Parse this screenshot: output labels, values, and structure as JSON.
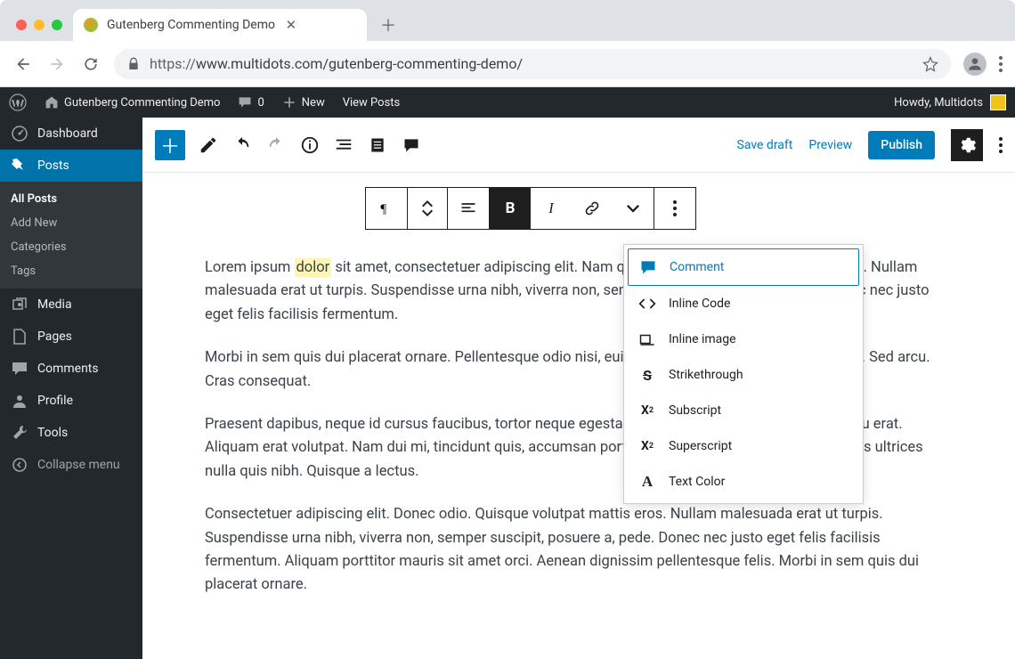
{
  "browser": {
    "tab_title": "Gutenberg Commenting Demo",
    "url_protocol": "https://",
    "url_rest": "www.multidots.com/gutenberg-commenting-demo/"
  },
  "adminbar": {
    "site_name": "Gutenberg Commenting Demo",
    "comment_count": "0",
    "new_label": "New",
    "view_posts": "View Posts",
    "howdy": "Howdy, Multidots"
  },
  "sidebar": {
    "dashboard": "Dashboard",
    "posts": "Posts",
    "posts_sub": {
      "all": "All Posts",
      "add": "Add New",
      "cats": "Categories",
      "tags": "Tags"
    },
    "media": "Media",
    "pages": "Pages",
    "comments": "Comments",
    "profile": "Profile",
    "tools": "Tools",
    "collapse": "Collapse menu"
  },
  "editor_top": {
    "save_draft": "Save draft",
    "preview": "Preview",
    "publish": "Publish"
  },
  "dropdown": {
    "comment": "Comment",
    "inline_code": "Inline Code",
    "inline_image": "Inline image",
    "strike": "Strikethrough",
    "subscript": "Subscript",
    "superscript": "Superscript",
    "text_color": "Text Color"
  },
  "content": {
    "p1a": "Lorem ipsum ",
    "p1_hl": "dolor",
    "p1b": " sit amet, consectetuer adipiscing elit. Nam quis nulla. Neque volutpat mattis eros. Nullam malesuada erat ut turpis. Suspendisse urna nibh, viverra non, semper suscipit, posuere a, pede. Donec nec justo eget felis facilisis fermentum.",
    "p2": "Morbi in sem quis dui placerat ornare. Pellentesque odio nisi, euismod in, pharetra a, ultricies in, diam. Sed arcu. Cras consequat.",
    "p3": "Praesent dapibus, neque id cursus faucibus, tortor neque egestas auguae, eu vulputate magna eros eu erat. Aliquam erat volutpat. Nam dui mi, tincidunt quis, accumsan porttitor, facilisis luctus, metus. Phasellus ultrices nulla quis nibh. Quisque a lectus.",
    "p4": "Consectetuer adipiscing elit. Donec odio. Quisque volutpat mattis eros. Nullam malesuada erat ut turpis. Suspendisse urna nibh, viverra non, semper suscipit, posuere a, pede. Donec nec justo eget felis facilisis fermentum. Aliquam porttitor mauris sit amet orci. Aenean dignissim pellentesque felis. Morbi in sem quis dui placerat ornare."
  }
}
